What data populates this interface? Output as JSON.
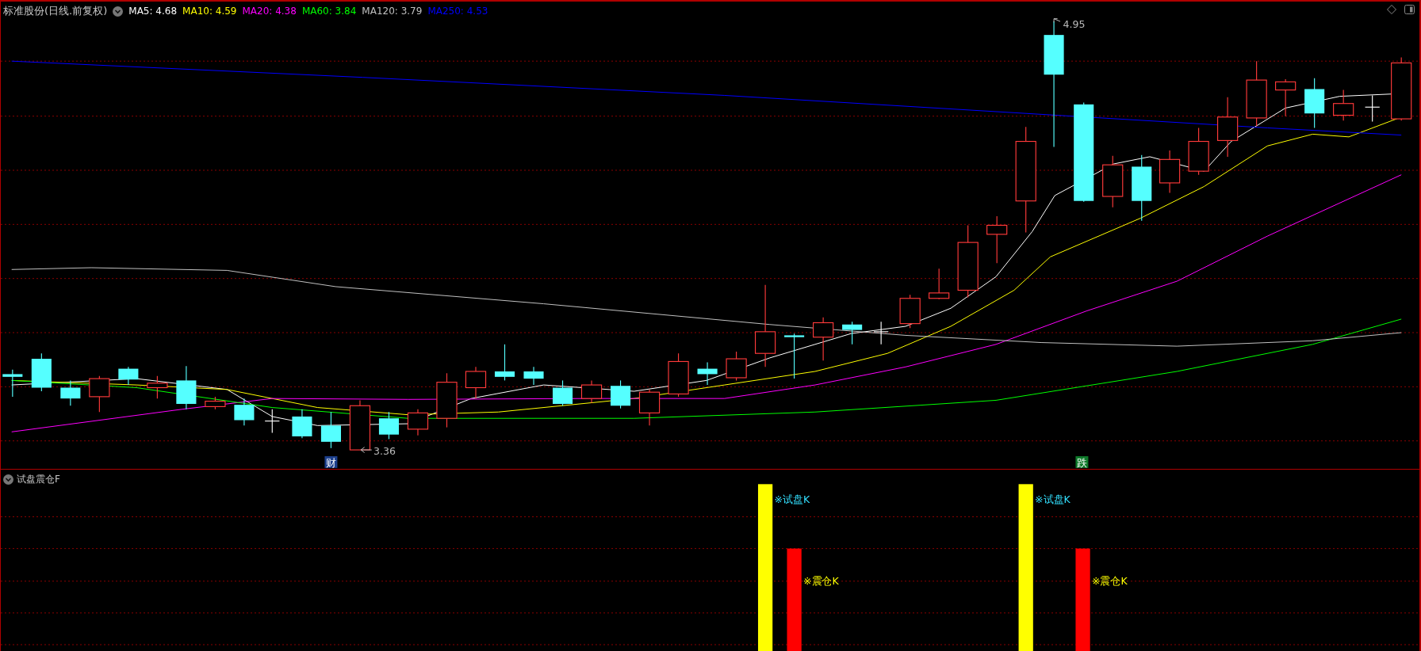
{
  "header": {
    "title": "标准股份(日线.前复权)",
    "moving_averages": [
      {
        "label": "MA5: 4.68",
        "color": "#ffffff"
      },
      {
        "label": "MA10: 4.59",
        "color": "#ffff00"
      },
      {
        "label": "MA20: 4.38",
        "color": "#ff00ff"
      },
      {
        "label": "MA60: 3.84",
        "color": "#00ff00"
      },
      {
        "label": "MA120: 3.79",
        "color": "#c0c0c0"
      },
      {
        "label": "MA250: 4.53",
        "color": "#0000ff"
      }
    ]
  },
  "price_chart": {
    "high_marker": "4.95",
    "low_marker": "3.36",
    "event_tags": [
      {
        "label": "财",
        "color": "#1c3f8c"
      },
      {
        "label": "跌",
        "color": "#0e7a2a"
      }
    ]
  },
  "indicator_panel": {
    "title": "试盘震仓F",
    "signals": [
      {
        "kind": "trial",
        "label": "※试盘K"
      },
      {
        "kind": "shakeout",
        "label": "※震仓K"
      },
      {
        "kind": "trial",
        "label": "※试盘K"
      },
      {
        "kind": "shakeout",
        "label": "※震仓K"
      }
    ]
  }
}
